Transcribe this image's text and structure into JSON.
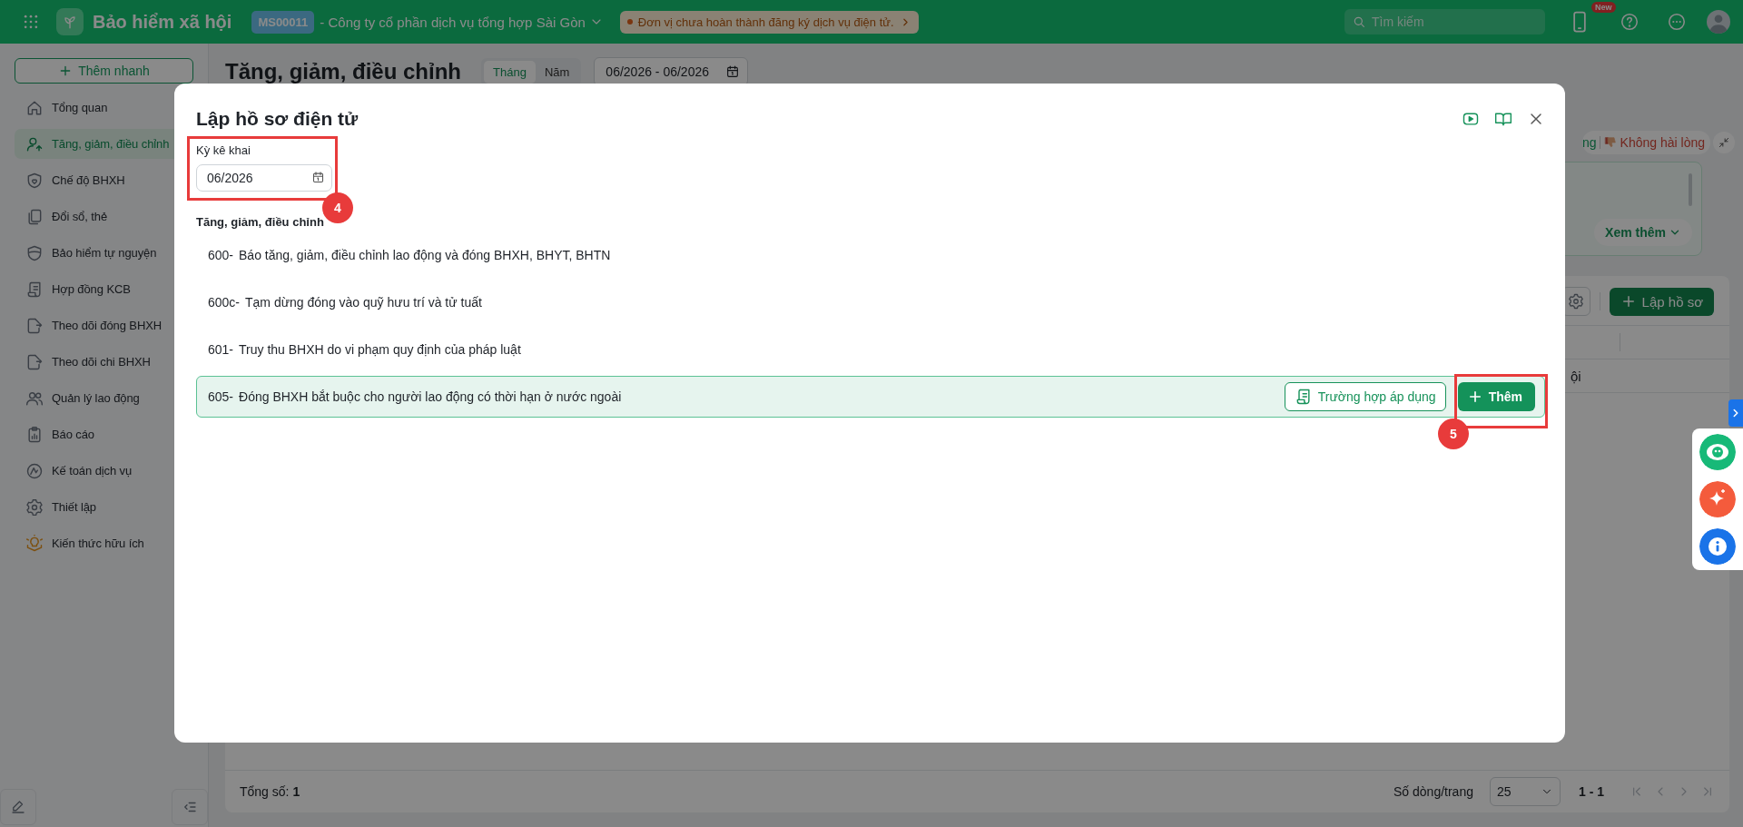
{
  "top_bar": {
    "app_title": "Bảo hiểm xã hội",
    "company_code": "MS00011",
    "company_name": "- Công ty cổ phần dịch vụ tổng hợp Sài Gòn",
    "notice": "Đơn vị chưa hoàn thành đăng ký dịch vụ điện tử.",
    "search": {
      "placeholder": "Tìm kiếm"
    },
    "new_badge": "New"
  },
  "sidebar": {
    "quick_add": "Thêm nhanh",
    "items": [
      {
        "label": "Tổng quan",
        "selected": false
      },
      {
        "label": "Tăng, giảm, điều chỉnh",
        "selected": true
      },
      {
        "label": "Chế độ BHXH",
        "selected": false
      },
      {
        "label": "Đổi sổ, thẻ",
        "selected": false
      },
      {
        "label": "Bảo hiểm tự nguyện",
        "selected": false
      },
      {
        "label": "Hợp đồng KCB",
        "selected": false
      },
      {
        "label": "Theo dõi đóng BHXH",
        "selected": false
      },
      {
        "label": "Theo dõi chi BHXH",
        "selected": false
      },
      {
        "label": "Quản lý lao động",
        "selected": false
      },
      {
        "label": "Báo cáo",
        "selected": false
      },
      {
        "label": "Kế toán dịch vụ",
        "selected": false
      },
      {
        "label": "Thiết lập",
        "selected": false
      },
      {
        "label": "Kiến thức hữu ích",
        "selected": false
      }
    ]
  },
  "page": {
    "title": "Tăng, giảm, điều chỉnh",
    "period_tabs": [
      {
        "label": "Tháng",
        "selected": true
      },
      {
        "label": "Năm",
        "selected": false
      }
    ],
    "date_range": "06/2026 - 06/2026",
    "feedback_partial": "ng",
    "feedback_dislike": "Không hài lòng",
    "more_button": "Xem thêm",
    "create_button": "Lập hồ sơ",
    "table_cell": "ội",
    "footer": {
      "total": "Tổng số: **1**",
      "rows_per_page_label": "Số dòng/trang",
      "rows_per_page": "25",
      "range": "1 - 1"
    }
  },
  "modal": {
    "title": "Lập hồ sơ điện tử",
    "period_label": "Kỳ kê khai",
    "period_value": "06/2026",
    "period_annotation": "4",
    "section": "Tăng, giảm, điều chỉnh",
    "forms": [
      {
        "code": "600-",
        "name": "Báo tăng, giảm, điều chỉnh lao động và đóng BHXH, BHYT, BHTN",
        "selected": false
      },
      {
        "code": "600c-",
        "name": "Tạm dừng đóng vào quỹ hưu trí và tử tuất",
        "selected": false
      },
      {
        "code": "601-",
        "name": "Truy thu BHXH do vi phạm quy định của pháp luật",
        "selected": false
      },
      {
        "code": "605-",
        "name": "Đóng BHXH bắt buộc cho người lao động có thời hạn ở nước ngoài",
        "selected": true
      }
    ],
    "apply_button": "Trường hợp áp dụng",
    "add_button": "Thêm",
    "add_annotation": "5"
  }
}
